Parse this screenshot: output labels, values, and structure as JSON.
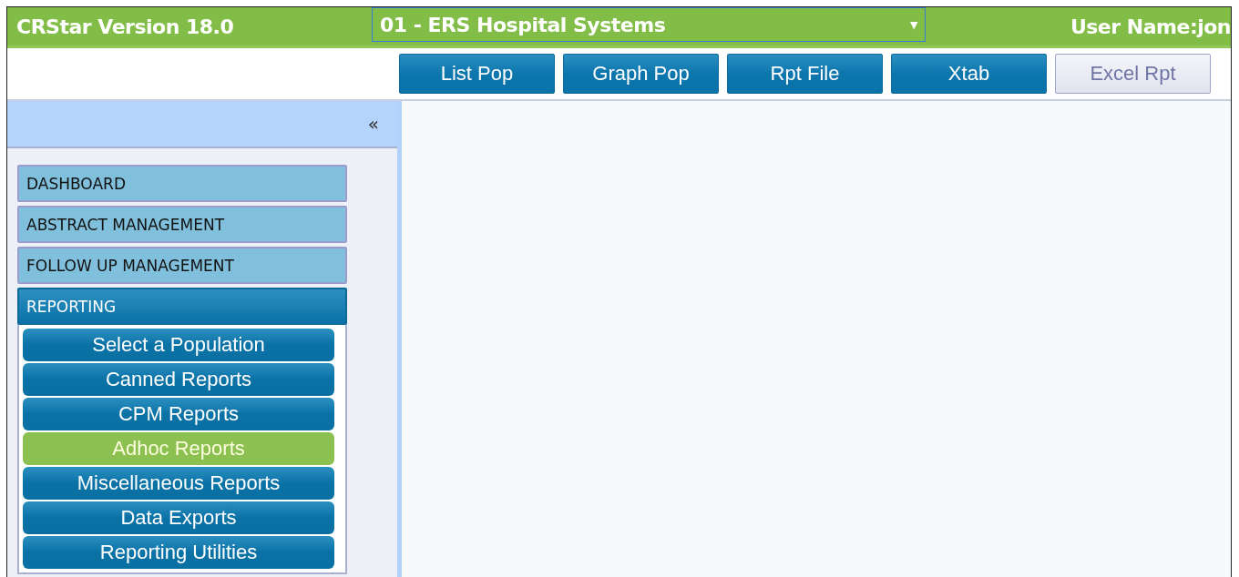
{
  "header": {
    "title": "CRStar Version 18.0",
    "hospital_select": {
      "value": "01 - ERS Hospital Systems",
      "arrow": "▼"
    },
    "user": "User Name:jon"
  },
  "toolbar": [
    {
      "label": "List Pop",
      "disabled": false
    },
    {
      "label": "Graph Pop",
      "disabled": false
    },
    {
      "label": "Rpt File",
      "disabled": false
    },
    {
      "label": "Xtab",
      "disabled": false
    },
    {
      "label": "Excel Rpt",
      "disabled": true
    }
  ],
  "sidebar": {
    "collapse": "«",
    "sections": [
      {
        "label": "DASHBOARD",
        "expanded": false
      },
      {
        "label": "ABSTRACT MANAGEMENT",
        "expanded": false
      },
      {
        "label": "FOLLOW UP MANAGEMENT",
        "expanded": false
      },
      {
        "label": "REPORTING",
        "expanded": true,
        "items": [
          {
            "label": "Select a Population",
            "selected": false
          },
          {
            "label": "Canned Reports",
            "selected": false
          },
          {
            "label": "CPM Reports",
            "selected": false
          },
          {
            "label": "Adhoc Reports",
            "selected": true
          },
          {
            "label": "Miscellaneous Reports",
            "selected": false
          },
          {
            "label": "Data Exports",
            "selected": false
          },
          {
            "label": "Reporting Utilities",
            "selected": false
          }
        ]
      }
    ]
  }
}
